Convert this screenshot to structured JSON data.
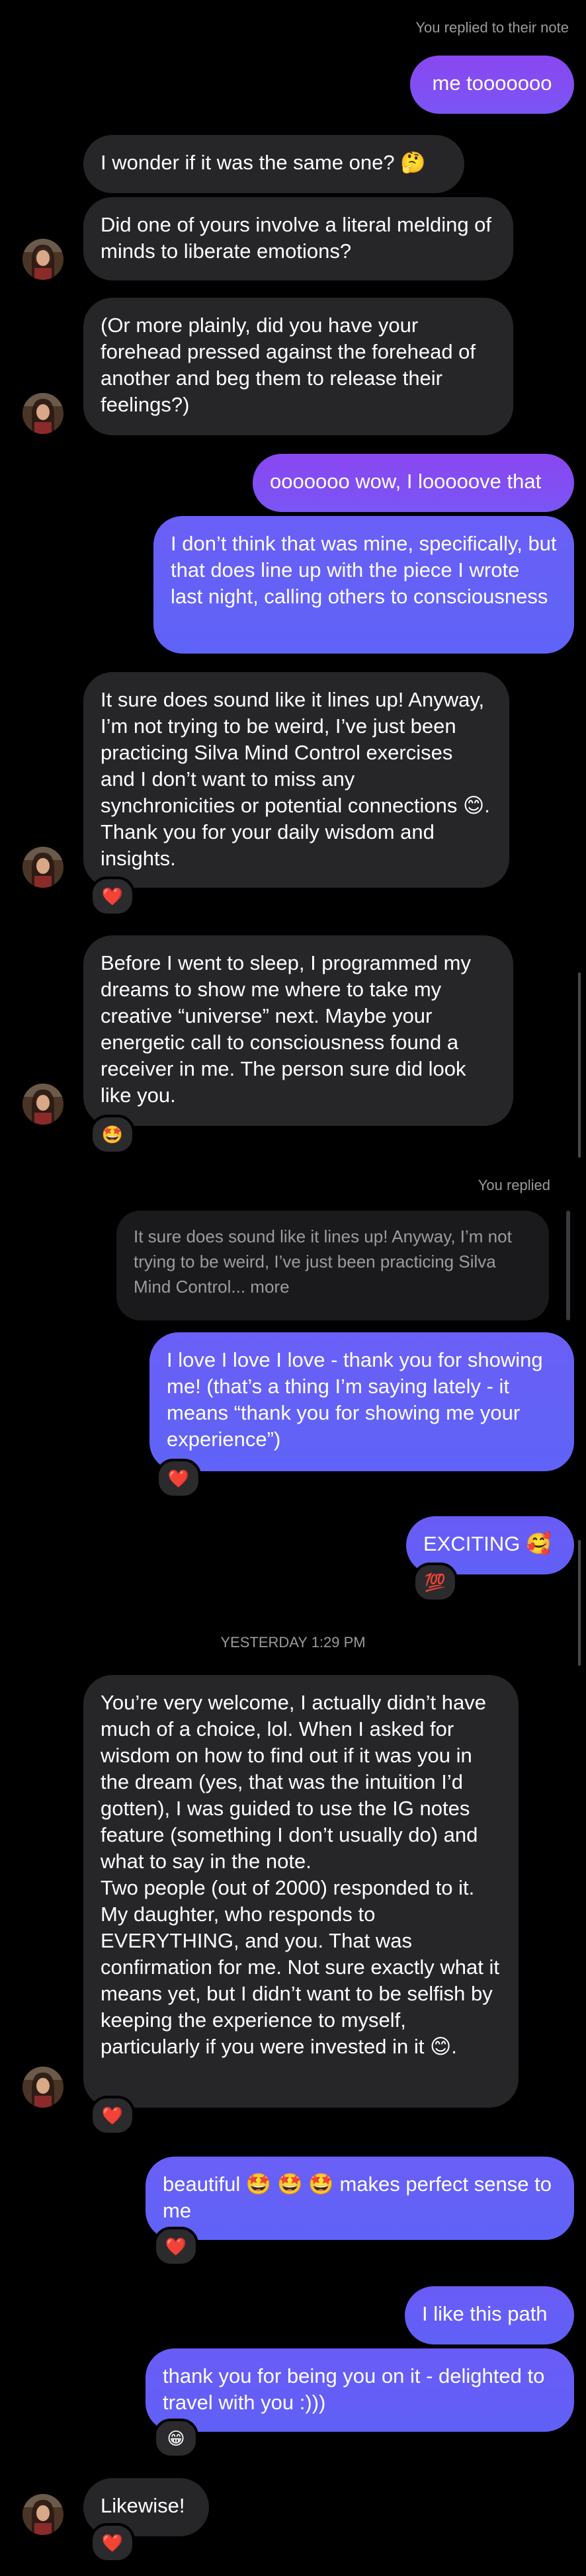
{
  "colors": {
    "background": "#000000",
    "incoming_bubble": "#262628",
    "outgoing_bubble": "#7a5af8",
    "reply_preview_bubble": "#1a1a1c",
    "meta_text": "#9a9a9e"
  },
  "thread": {
    "reply_note_label": "You replied to their note",
    "reply_label": "You replied",
    "date_divider": "YESTERDAY 1:29 PM"
  },
  "messages": {
    "m1": {
      "sender": "me",
      "text": "me tooooooo"
    },
    "m2": {
      "sender": "them",
      "text": "I wonder if it was the same one? 🤔"
    },
    "m3": {
      "sender": "them",
      "text": "Did one of yours involve a literal melding of minds to liberate emotions?"
    },
    "m4": {
      "sender": "them",
      "text": "(Or more plainly, did you have your forehead pressed against the forehead of another and beg them to release their feelings?)"
    },
    "m5": {
      "sender": "me",
      "text": "ooooooo wow, I looooove that"
    },
    "m6": {
      "sender": "me",
      "text": "I don’t think that was mine, specifically, but that does line up with the piece I wrote last night, calling others to consciousness"
    },
    "m7": {
      "sender": "them",
      "text": "It sure does sound like it lines up! Anyway, I’m not trying to be weird, I’ve just been practicing Silva Mind Control exercises and I don’t want to miss any synchronicities or potential connections 😊. Thank you for your daily wisdom and insights.",
      "reaction": "❤️"
    },
    "m8": {
      "sender": "them",
      "text": "Before I went to sleep, I programmed my dreams to show me where to take my creative “universe” next. Maybe your energetic call to consciousness found a receiver in me. The person sure did look like you.",
      "reaction": "🤩"
    },
    "m9_quote": {
      "text": "It sure does sound like it lines up! Anyway, I’m not trying to be weird, I’ve just been practicing Silva Mind Control... more"
    },
    "m9": {
      "sender": "me",
      "text": "I love I love I love - thank you for showing me! (that’s a thing I’m saying lately - it means “thank you for showing me your experience”)",
      "reaction": "❤️"
    },
    "m10": {
      "sender": "me",
      "text": "EXCITING 🥰",
      "reaction": "💯"
    },
    "m11": {
      "sender": "them",
      "text": "You’re very welcome, I actually didn’t have much of a choice, lol. When I asked for wisdom on how to find out if it was you in the dream (yes, that was the intuition I’d gotten), I was guided to use the IG notes feature (something I don’t usually do) and what to say in the note.\n  Two people (out of 2000) responded to it. My daughter, who responds to EVERYTHING, and you. That was confirmation for me. Not sure exactly what it means yet, but I didn’t want to be selfish by keeping the experience to myself, particularly if you were invested in it 😊.",
      "reaction": "❤️"
    },
    "m12": {
      "sender": "me",
      "text": "beautiful 🤩 🤩 🤩 makes perfect sense to me",
      "reaction": "❤️"
    },
    "m13": {
      "sender": "me",
      "text": "I like this path"
    },
    "m14": {
      "sender": "me",
      "text": "thank you for being you on it - delighted to travel with you :)))",
      "reaction": "😁"
    },
    "m15": {
      "sender": "them",
      "text": "Likewise!",
      "reaction": "❤️"
    }
  }
}
